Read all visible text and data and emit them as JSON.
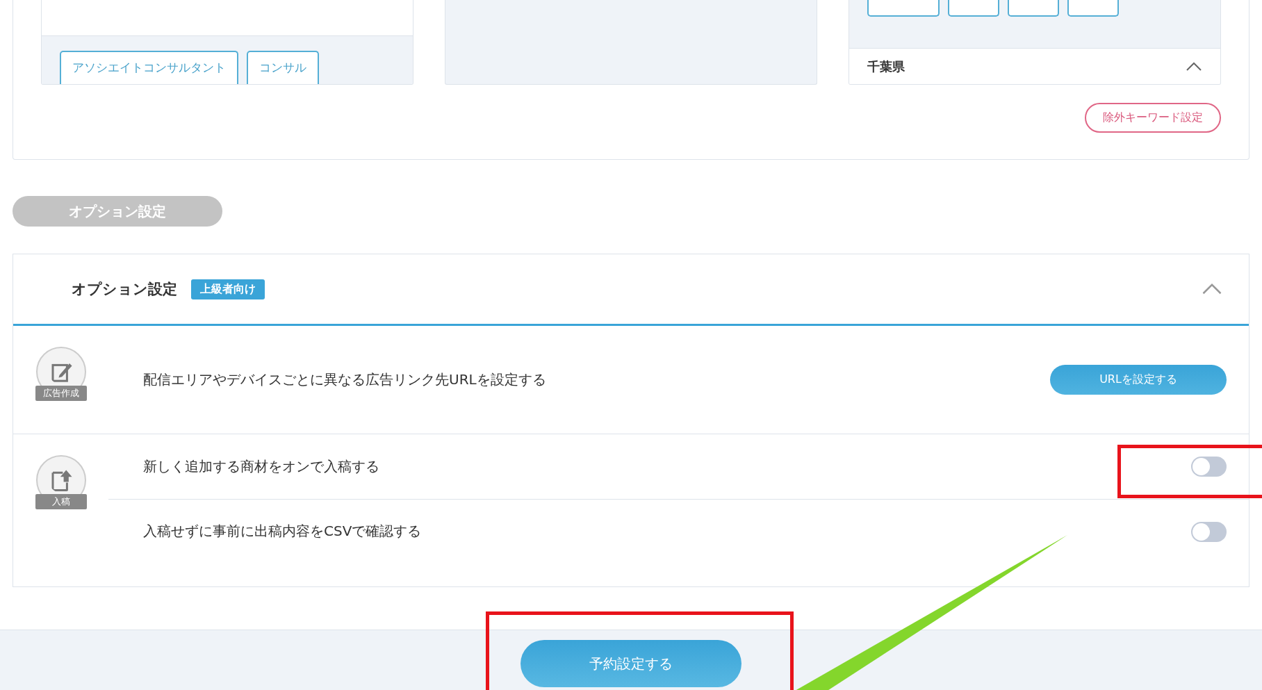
{
  "job_card": {
    "tags": [
      "アソシエイトコンサルタント",
      "コンサル"
    ]
  },
  "area_card": {
    "region": "千葉県",
    "expanded": true
  },
  "exclude_keyword_button": "除外キーワード設定",
  "section_pill": "オプション設定",
  "options": {
    "title": "オプション設定",
    "badge": "上級者向け",
    "expanded": true,
    "groups": [
      {
        "kind": "edit",
        "icon_label": "広告作成",
        "items": [
          {
            "kind": "button",
            "text": "配信エリアやデバイスごとに異なる広告リンク先URLを設定する",
            "button": "URLを設定する"
          }
        ]
      },
      {
        "kind": "upload",
        "icon_label": "入稿",
        "items": [
          {
            "kind": "toggle",
            "text": "新しく追加する商材をオンで入稿する",
            "on": false
          },
          {
            "kind": "toggle",
            "text": "入稿せずに事前に出稿内容をCSVで確認する",
            "on": false
          }
        ]
      }
    ]
  },
  "submit_button": "予約設定する"
}
